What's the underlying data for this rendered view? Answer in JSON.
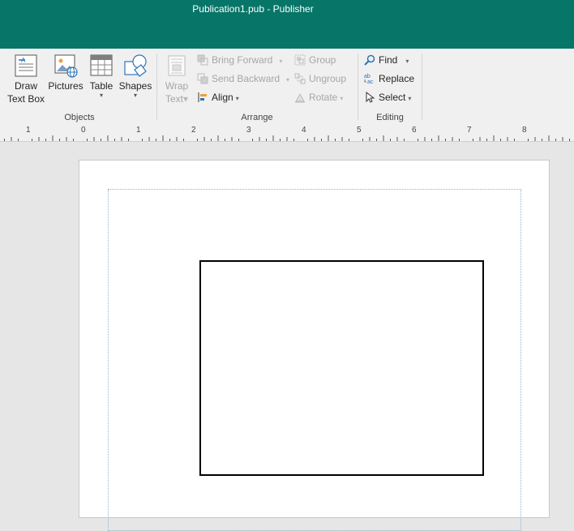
{
  "titlebar": {
    "title": "Publication1.pub  -  Publisher"
  },
  "ribbon": {
    "objects": {
      "label": "Objects",
      "draw_text_box": [
        "Draw",
        "Text Box"
      ],
      "pictures": "Pictures",
      "table": "Table",
      "shapes": "Shapes"
    },
    "arrange": {
      "label": "Arrange",
      "wrap_text": [
        "Wrap",
        "Text"
      ],
      "bring_forward": "Bring Forward",
      "send_backward": "Send Backward",
      "align": "Align",
      "group": "Group",
      "ungroup": "Ungroup",
      "rotate": "Rotate"
    },
    "editing": {
      "label": "Editing",
      "find": "Find",
      "replace": "Replace",
      "select": "Select"
    }
  },
  "ruler": {
    "labels": [
      "1",
      "0",
      "1",
      "2",
      "3",
      "4",
      "5",
      "6",
      "7",
      "8"
    ]
  },
  "colors": {
    "titlebar": "#077568",
    "ribbon": "#f0f0f0",
    "workspace": "#e6e6e6",
    "accent_icon": "#2e75b6"
  }
}
